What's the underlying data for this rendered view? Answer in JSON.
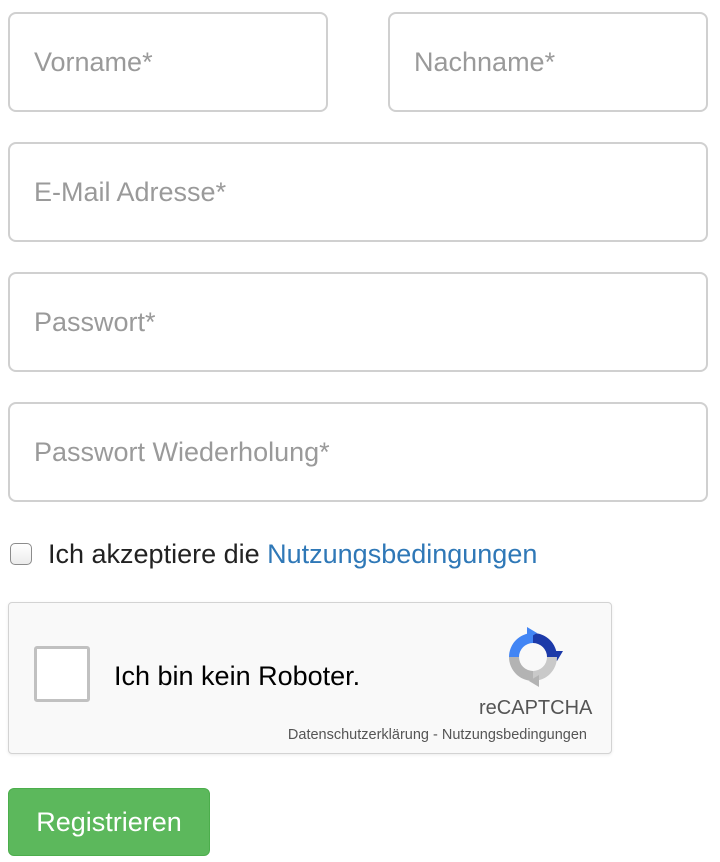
{
  "form": {
    "first_name": {
      "placeholder": "Vorname*",
      "value": ""
    },
    "last_name": {
      "placeholder": "Nachname*",
      "value": ""
    },
    "email": {
      "placeholder": "E-Mail Adresse*",
      "value": ""
    },
    "password": {
      "placeholder": "Passwort*",
      "value": ""
    },
    "password_repeat": {
      "placeholder": "Passwort Wiederholung*",
      "value": ""
    },
    "terms": {
      "checked": false,
      "label": "Ich akzeptiere die ",
      "link": "Nutzungsbedingungen"
    },
    "submit_label": "Registrieren"
  },
  "recaptcha": {
    "label": "Ich bin kein Roboter.",
    "brand": "reCAPTCHA",
    "privacy_link": "Datenschutzerklärung",
    "separator": " - ",
    "terms_link": "Nutzungsbedingungen",
    "logo_icon": "recaptcha-logo-icon"
  },
  "colors": {
    "link": "#2f78b7",
    "submit_bg": "#5cb85c",
    "field_border": "#d0d0d0",
    "placeholder": "#9a9a9a"
  }
}
